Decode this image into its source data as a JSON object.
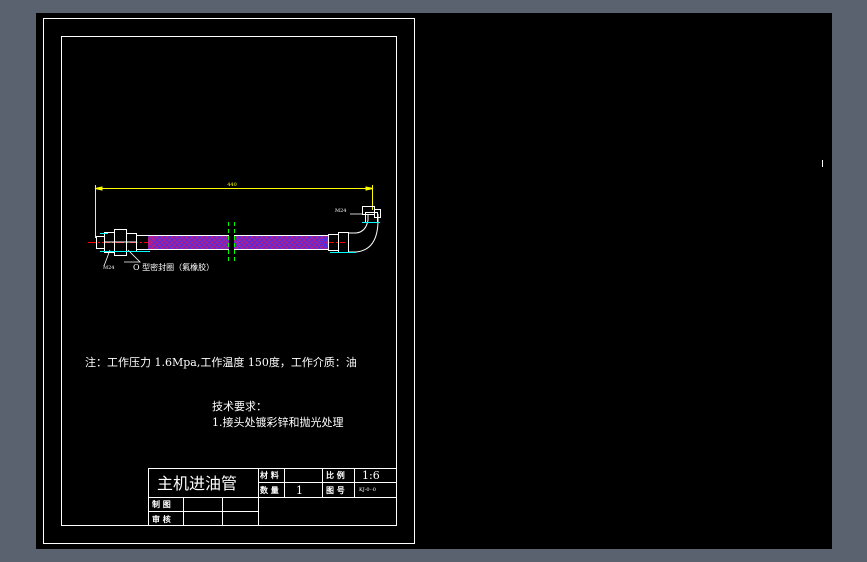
{
  "drawing": {
    "overall_dimension": "440",
    "label_top_right": "M24",
    "label_bottom_left": "M24",
    "seal_note": "O 型密封圈（氟橡胶）",
    "note": "注：工作压力 1.6Mpa,工作温度 150度，工作介质：油",
    "tech_title": "技术要求：",
    "tech_item": "1.接头处镀彩锌和抛光处理"
  },
  "title_block": {
    "part_name": "主机进油管",
    "material_label": "材 料",
    "material_value": "",
    "quantity_label": "数 量",
    "quantity_value": "1",
    "scale_label": "比 例",
    "scale_value": "1:6",
    "drawing_no_label": "图 号",
    "drawing_no_value": "KJ-0··0",
    "drawn_label": "制 图",
    "checked_label": "审 核"
  },
  "colors": {
    "background": "#5a6270",
    "canvas": "#000000",
    "lines": "#ffffff",
    "dimension": "#ffff00",
    "hose_fill": "#ff00ff",
    "hose_mesh": "#0000ff",
    "centerline": "#ff0000",
    "axis_mark": "#00ff00",
    "callout": "#00ffff"
  }
}
